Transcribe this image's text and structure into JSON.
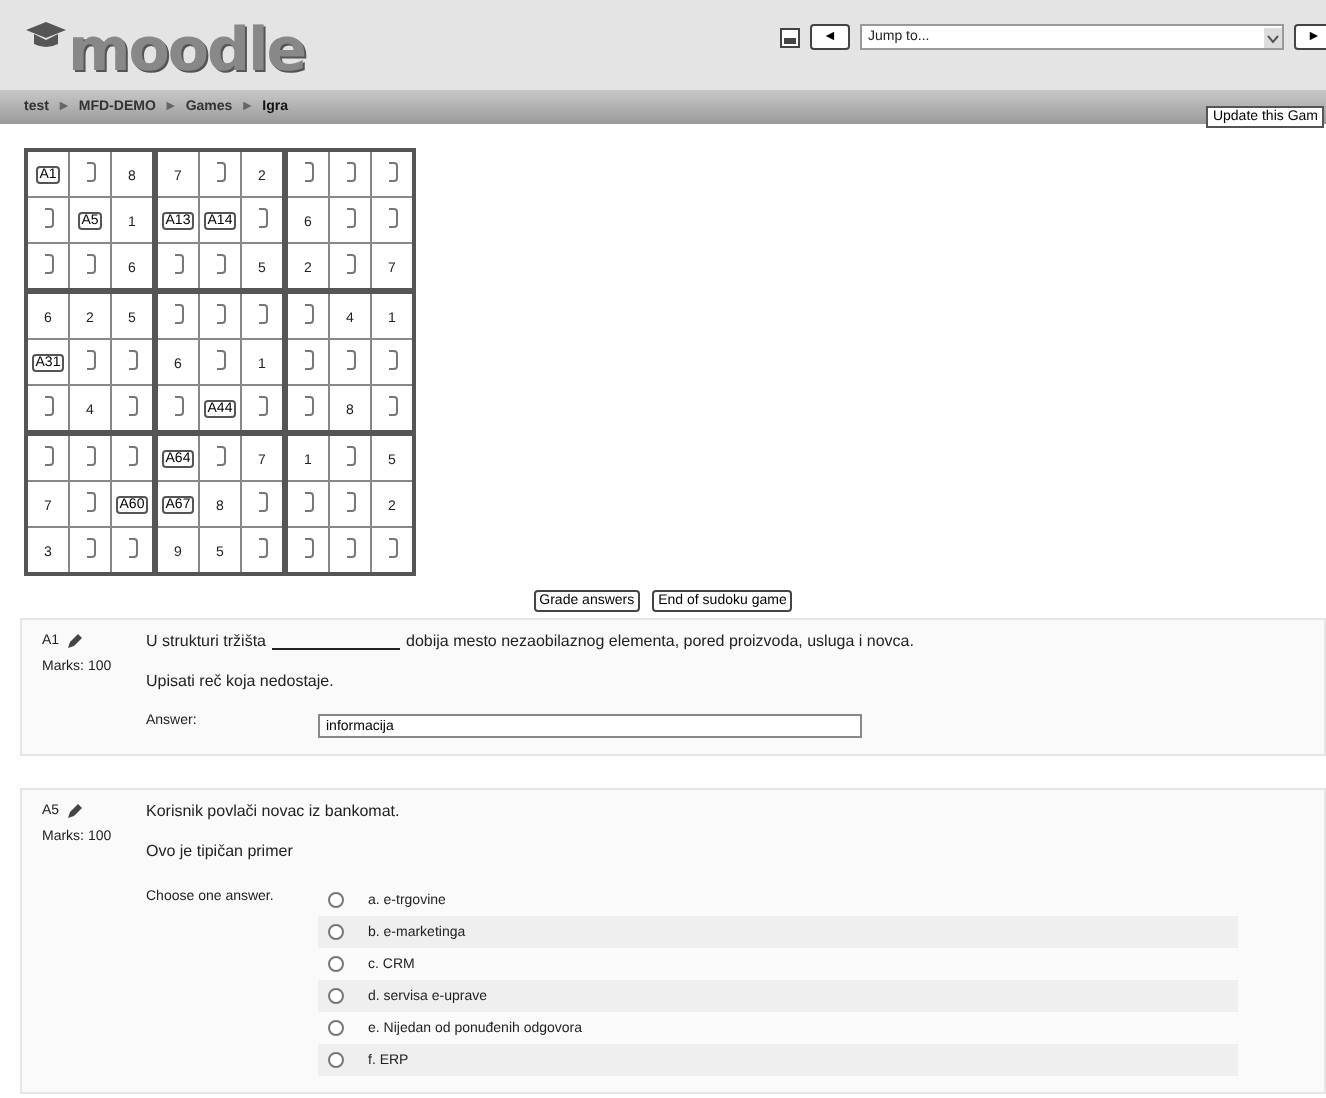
{
  "header": {
    "logo": "moodle",
    "nav_prev": "◄",
    "jump_placeholder": "Jump to...",
    "nav_next": "►"
  },
  "breadcrumb": {
    "items": [
      "test",
      "MFD-DEMO",
      "Games",
      "Igra"
    ],
    "separator": "►"
  },
  "update_button": "Update this Gam",
  "sudoku": {
    "rows": [
      [
        {
          "kind": "question",
          "text": "A1"
        },
        {
          "kind": "empty"
        },
        {
          "kind": "given",
          "text": "8"
        },
        {
          "kind": "given",
          "text": "7"
        },
        {
          "kind": "empty"
        },
        {
          "kind": "given",
          "text": "2"
        },
        {
          "kind": "empty"
        },
        {
          "kind": "empty"
        },
        {
          "kind": "empty"
        }
      ],
      [
        {
          "kind": "empty"
        },
        {
          "kind": "question",
          "text": "A5"
        },
        {
          "kind": "given",
          "text": "1"
        },
        {
          "kind": "question",
          "text": "A13"
        },
        {
          "kind": "question",
          "text": "A14"
        },
        {
          "kind": "empty"
        },
        {
          "kind": "given",
          "text": "6"
        },
        {
          "kind": "empty"
        },
        {
          "kind": "empty"
        }
      ],
      [
        {
          "kind": "empty"
        },
        {
          "kind": "empty"
        },
        {
          "kind": "given",
          "text": "6"
        },
        {
          "kind": "empty"
        },
        {
          "kind": "empty"
        },
        {
          "kind": "given",
          "text": "5"
        },
        {
          "kind": "given",
          "text": "2"
        },
        {
          "kind": "empty"
        },
        {
          "kind": "given",
          "text": "7"
        }
      ],
      [
        {
          "kind": "given",
          "text": "6"
        },
        {
          "kind": "given",
          "text": "2"
        },
        {
          "kind": "given",
          "text": "5"
        },
        {
          "kind": "empty"
        },
        {
          "kind": "empty"
        },
        {
          "kind": "empty"
        },
        {
          "kind": "empty"
        },
        {
          "kind": "given",
          "text": "4"
        },
        {
          "kind": "given",
          "text": "1"
        }
      ],
      [
        {
          "kind": "question",
          "text": "A31"
        },
        {
          "kind": "empty"
        },
        {
          "kind": "empty"
        },
        {
          "kind": "given",
          "text": "6"
        },
        {
          "kind": "empty"
        },
        {
          "kind": "given",
          "text": "1"
        },
        {
          "kind": "empty"
        },
        {
          "kind": "empty"
        },
        {
          "kind": "empty"
        }
      ],
      [
        {
          "kind": "empty"
        },
        {
          "kind": "given",
          "text": "4"
        },
        {
          "kind": "empty"
        },
        {
          "kind": "empty"
        },
        {
          "kind": "question",
          "text": "A44"
        },
        {
          "kind": "empty"
        },
        {
          "kind": "empty"
        },
        {
          "kind": "given",
          "text": "8"
        },
        {
          "kind": "empty"
        }
      ],
      [
        {
          "kind": "empty"
        },
        {
          "kind": "empty"
        },
        {
          "kind": "empty"
        },
        {
          "kind": "question",
          "text": "A64"
        },
        {
          "kind": "empty"
        },
        {
          "kind": "given",
          "text": "7"
        },
        {
          "kind": "given",
          "text": "1"
        },
        {
          "kind": "empty"
        },
        {
          "kind": "given",
          "text": "5"
        }
      ],
      [
        {
          "kind": "given",
          "text": "7"
        },
        {
          "kind": "empty"
        },
        {
          "kind": "question",
          "text": "A60"
        },
        {
          "kind": "question",
          "text": "A67"
        },
        {
          "kind": "given",
          "text": "8"
        },
        {
          "kind": "empty"
        },
        {
          "kind": "empty"
        },
        {
          "kind": "empty"
        },
        {
          "kind": "given",
          "text": "2"
        }
      ],
      [
        {
          "kind": "given",
          "text": "3"
        },
        {
          "kind": "empty"
        },
        {
          "kind": "empty"
        },
        {
          "kind": "given",
          "text": "9"
        },
        {
          "kind": "given",
          "text": "5"
        },
        {
          "kind": "empty"
        },
        {
          "kind": "empty"
        },
        {
          "kind": "empty"
        },
        {
          "kind": "empty"
        }
      ]
    ]
  },
  "actions": [
    "Grade answers",
    "End of sudoku game"
  ],
  "questions": [
    {
      "kind": "shortanswer",
      "number": "A1",
      "marks": "Marks: 100",
      "text_before": "U strukturi tržišta",
      "text_after": "dobija mesto nezaobilaznog elementa, pored proizvoda, usluga i novca.",
      "instruction": "Upisati reč koja nedostaje.",
      "answer_label": "Answer:",
      "answer_value": "informacija"
    },
    {
      "kind": "multichoice",
      "number": "A5",
      "marks": "Marks: 100",
      "text": "Korisnik povlači novac iz bankomat.",
      "instruction": "Ovo je tipičan primer",
      "answer_label": "Choose one answer.",
      "options": [
        {
          "label": "a. e-trgovine",
          "selected": false
        },
        {
          "label": "b. e-marketinga",
          "selected": false
        },
        {
          "label": "c. CRM",
          "selected": false
        },
        {
          "label": "d. servisa e-uprave",
          "selected": false
        },
        {
          "label": "e. Nijedan od ponuđenih odgovora",
          "selected": false
        },
        {
          "label": "f. ERP",
          "selected": false
        }
      ]
    }
  ]
}
